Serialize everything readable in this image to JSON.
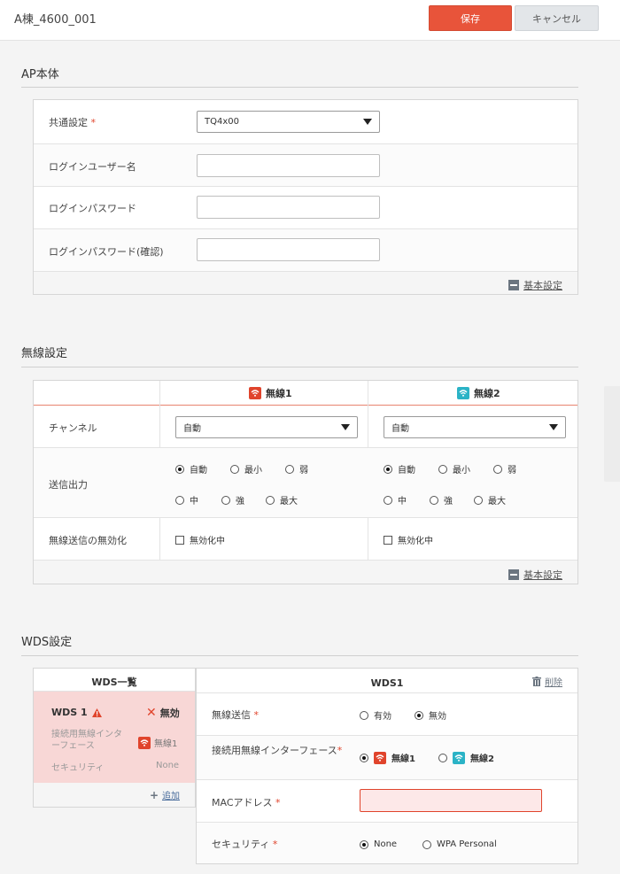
{
  "header": {
    "title": "A棟_4600_001",
    "save_label": "保存",
    "cancel_label": "キャンセル"
  },
  "ap": {
    "section_title": "AP本体",
    "common_label": "共通設定",
    "common_value": "TQ4x00",
    "login_user_label": "ログインユーザー名",
    "login_pass_label": "ログインパスワード",
    "login_pass_confirm_label": "ログインパスワード(確認)",
    "basic_link": "基本設定"
  },
  "wireless": {
    "section_title": "無線設定",
    "col1": "無線1",
    "col2": "無線2",
    "channel_label": "チャンネル",
    "channel_value1": "自動",
    "channel_value2": "自動",
    "power_label": "送信出力",
    "power_options": [
      "自動",
      "最小",
      "弱",
      "中",
      "強",
      "最大"
    ],
    "disable_label": "無線送信の無効化",
    "disable_option": "無効化中",
    "basic_link": "基本設定",
    "colors": {
      "wifi1": "#e0442c",
      "wifi2": "#2bb3c6"
    }
  },
  "wds": {
    "section_title": "WDS設定",
    "list_header": "WDS一覧",
    "item_name": "WDS 1",
    "item_status": "無効",
    "item_iface_label": "接続用無線インターフェース",
    "item_iface_value": "無線1",
    "item_security_label": "セキュリティ",
    "item_security_value": "None",
    "add_label": "追加",
    "detail_header": "WDS1",
    "delete_label": "削除",
    "tx_label": "無線送信",
    "tx_on": "有効",
    "tx_off": "無効",
    "iface_label": "接続用無線インターフェース",
    "iface_opt1": "無線1",
    "iface_opt2": "無線2",
    "mac_label": "MACアドレス",
    "security_label": "セキュリティ",
    "security_opt1": "None",
    "security_opt2": "WPA Personal"
  },
  "required_mark": "*"
}
